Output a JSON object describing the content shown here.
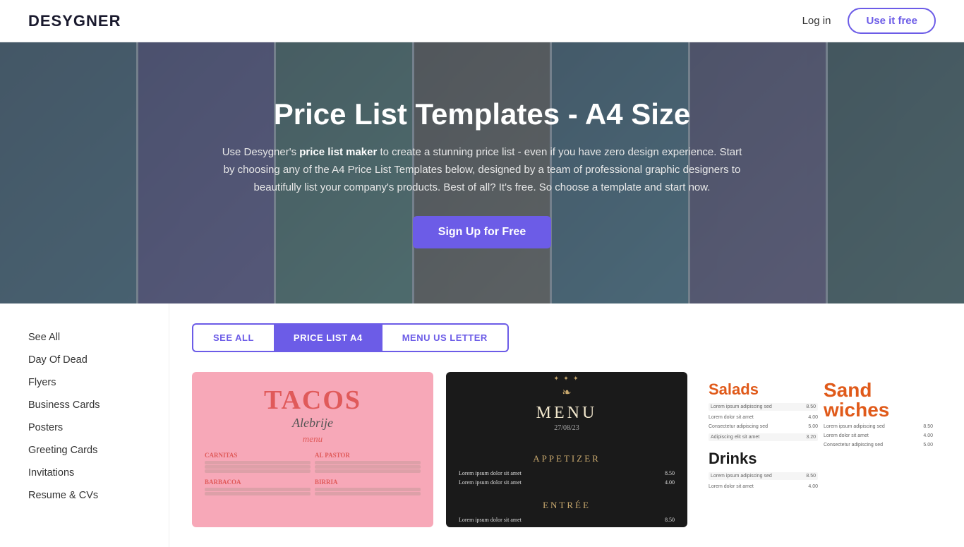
{
  "navbar": {
    "logo": "DESYGNER",
    "login_label": "Log in",
    "cta_label": "Use it free"
  },
  "hero": {
    "title": "Price List Templates - A4 Size",
    "description_plain": "Use Desygner's ",
    "description_bold": "price list maker",
    "description_rest": " to create a stunning price list - even if you have zero design experience. Start by choosing any of the A4 Price List Templates below, designed by a team of professional graphic designers to beautifully list your company's products. Best of all? It's free. So choose a template and start now.",
    "cta_label": "Sign Up for Free"
  },
  "sidebar": {
    "items": [
      {
        "label": "See All"
      },
      {
        "label": "Day Of Dead"
      },
      {
        "label": "Flyers"
      },
      {
        "label": "Business Cards"
      },
      {
        "label": "Posters"
      },
      {
        "label": "Greeting Cards"
      },
      {
        "label": "Invitations"
      },
      {
        "label": "Resume & CVs"
      }
    ]
  },
  "filter_tabs": [
    {
      "label": "SEE ALL",
      "active": false
    },
    {
      "label": "PRICE LIST A4",
      "active": true
    },
    {
      "label": "MENU US LETTER",
      "active": false
    }
  ],
  "templates": [
    {
      "id": "tacos",
      "type": "tacos-card",
      "title": "TACOS",
      "subtitle": "Alebrije",
      "label": "menu",
      "sections": [
        "CARNITAS",
        "AL PASTOR",
        "BARBACOA",
        "BIRRIA"
      ]
    },
    {
      "id": "menu-dark",
      "type": "menu-card",
      "label": "MENU",
      "date": "27/08/23",
      "sections": [
        "APPETIZER",
        "ENTRÉE"
      ]
    },
    {
      "id": "salads",
      "type": "salads-card",
      "sections": [
        "Salads",
        "Drinks",
        "Sand wiches"
      ]
    }
  ]
}
